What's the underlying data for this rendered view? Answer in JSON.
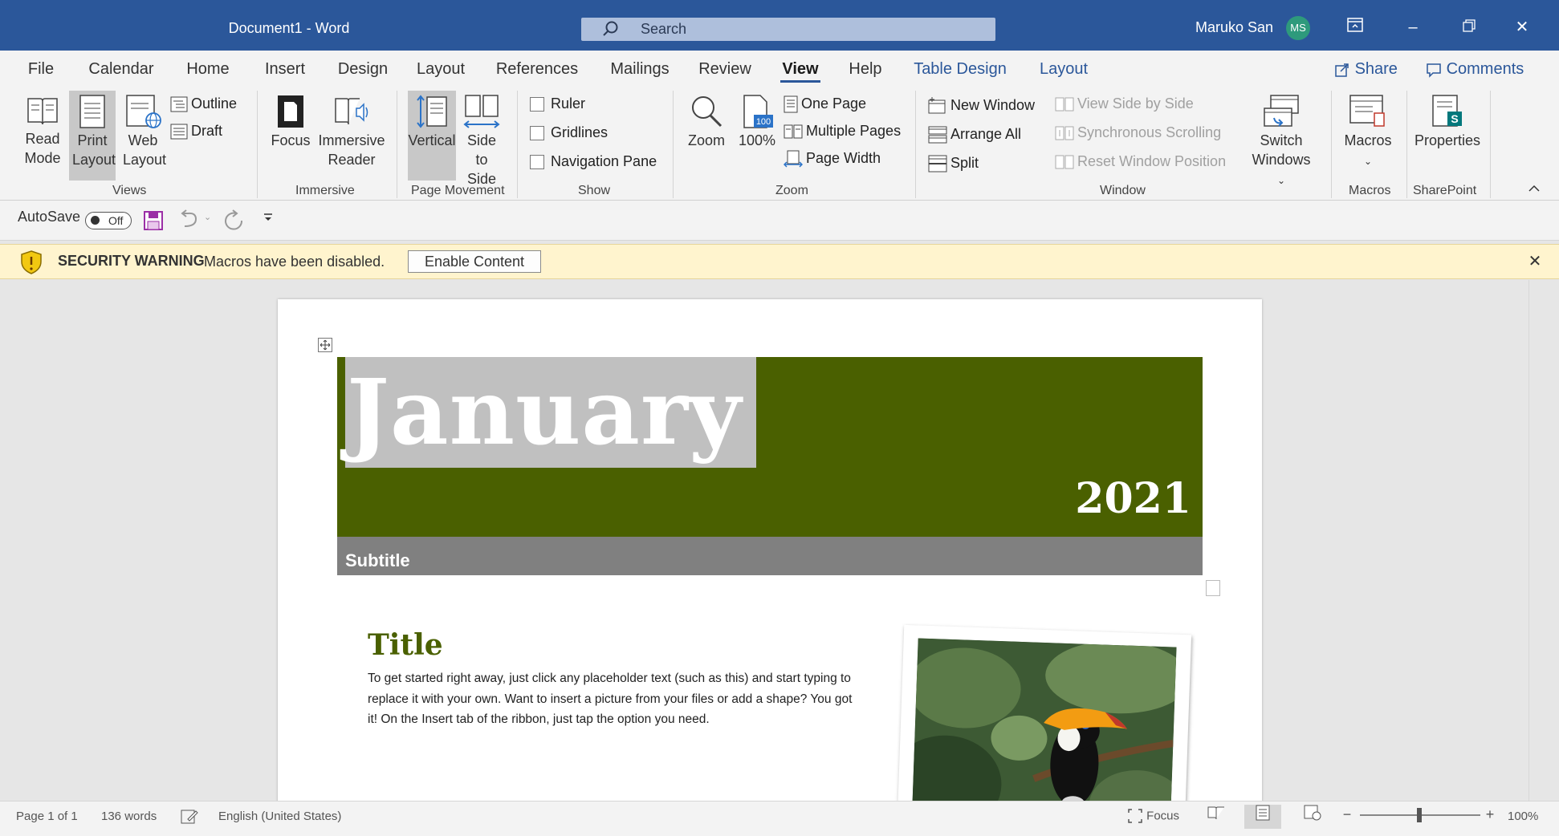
{
  "window": {
    "title": "Document1  -  Word",
    "search_placeholder": "Search",
    "user_name": "Maruko San",
    "user_initials": "MS"
  },
  "tabs": [
    "File",
    "Calendar",
    "Home",
    "Insert",
    "Design",
    "Layout",
    "References",
    "Mailings",
    "Review",
    "View",
    "Help",
    "Table Design",
    "Layout"
  ],
  "active_tab": "View",
  "actions": {
    "share": "Share",
    "comments": "Comments"
  },
  "ribbon": {
    "views": {
      "label": "Views",
      "read_mode": "Read Mode",
      "print_layout": "Print Layout",
      "web_layout": "Web Layout",
      "outline": "Outline",
      "draft": "Draft"
    },
    "immersive": {
      "label": "Immersive",
      "focus": "Focus",
      "immersive_reader": "Immersive Reader"
    },
    "page_movement": {
      "label": "Page Movement",
      "vertical": "Vertical",
      "side_to_side": "Side to Side"
    },
    "show": {
      "label": "Show",
      "ruler": "Ruler",
      "gridlines": "Gridlines",
      "navigation_pane": "Navigation Pane"
    },
    "zoom": {
      "label": "Zoom",
      "zoom": "Zoom",
      "hundred": "100%",
      "one_page": "One Page",
      "multiple_pages": "Multiple Pages",
      "page_width": "Page Width"
    },
    "window": {
      "label": "Window",
      "new_window": "New Window",
      "arrange_all": "Arrange All",
      "split": "Split",
      "view_side_by_side": "View Side by Side",
      "synchronous_scrolling": "Synchronous Scrolling",
      "reset_window_position": "Reset Window Position",
      "switch_windows": "Switch Windows"
    },
    "macros": {
      "label": "Macros",
      "macros": "Macros"
    },
    "sharepoint": {
      "label": "SharePoint",
      "properties": "Properties"
    }
  },
  "qat": {
    "autosave": "AutoSave",
    "toggle": "Off"
  },
  "security": {
    "header": "SECURITY WARNING",
    "message": "Macros have been disabled.",
    "button": "Enable Content"
  },
  "document": {
    "month": "January",
    "year": "2021",
    "subtitle": "Subtitle",
    "title": "Title",
    "body": "To get started right away, just click any placeholder text (such as this) and start typing to replace it with your own. Want to insert a picture from your files or add a shape? You got it! On the Insert tab of the ribbon, just tap the option you need."
  },
  "status": {
    "page": "Page 1 of 1",
    "words": "136 words",
    "language": "English (United States)",
    "focus": "Focus",
    "zoom": "100%"
  },
  "colors": {
    "title_bar": "#2b579a",
    "banner": "#4a6000",
    "month_bg": "#c0c0c0",
    "subtitle_bg": "#808080",
    "warning_bg": "#fff4ce"
  }
}
